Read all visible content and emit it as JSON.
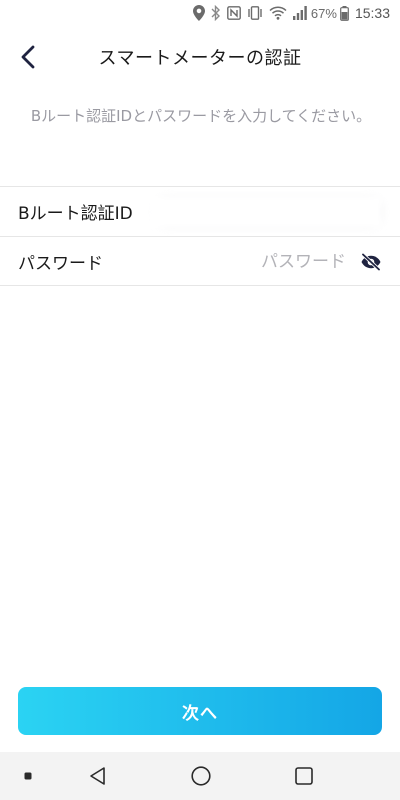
{
  "status_bar": {
    "battery_percent": "67%",
    "time": "15:33",
    "icons": [
      "location-icon",
      "bluetooth-icon",
      "nfc-icon",
      "vibrate-icon",
      "wifi-icon",
      "signal-icon",
      "battery-icon"
    ]
  },
  "header": {
    "title": "スマートメーターの認証",
    "back_icon": "chevron-left-icon"
  },
  "description": "Bルート認証IDとパスワードを入力してください。",
  "form": {
    "id_field": {
      "label": "Bルート認証ID",
      "value": ""
    },
    "password_field": {
      "label": "パスワード",
      "placeholder": "パスワード",
      "value": "",
      "toggle_icon": "eye-off-icon"
    }
  },
  "next_button": {
    "label": "次へ"
  },
  "colors": {
    "accent_start": "#2bd3f3",
    "accent_end": "#14a6e6",
    "hint_text": "#9a9aa2",
    "divider": "#e6e6e6"
  },
  "nav_bar": {
    "icons": [
      "recent-dot-icon",
      "back-triangle-icon",
      "home-circle-icon",
      "overview-square-icon"
    ]
  }
}
